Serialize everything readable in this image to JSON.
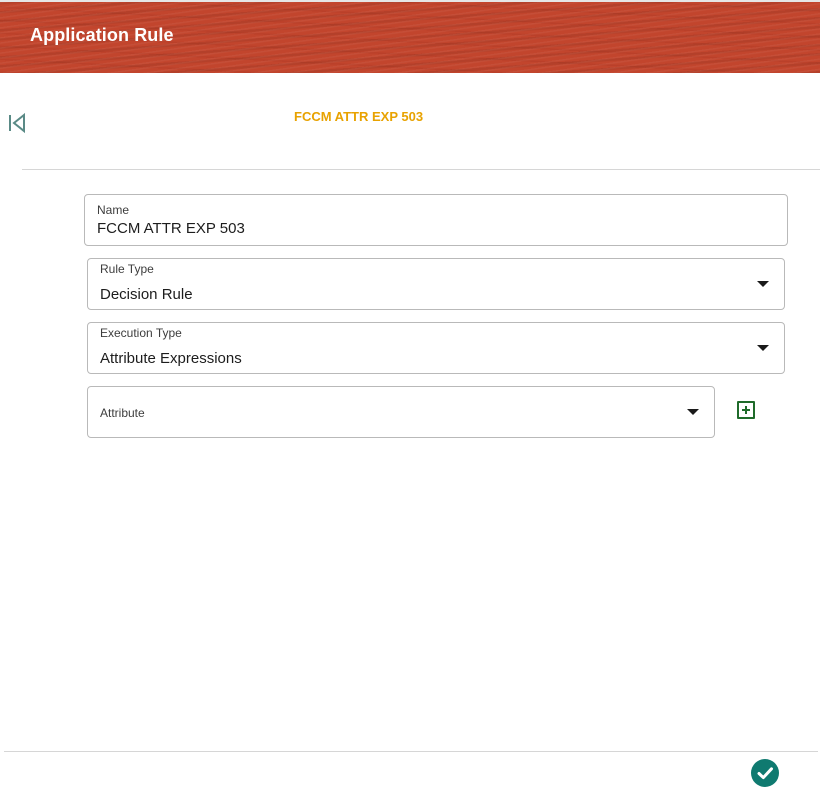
{
  "header": {
    "title": "Application Rule"
  },
  "record": {
    "title": "FCCM ATTR EXP 503"
  },
  "form": {
    "name": {
      "label": "Name",
      "value": "FCCM ATTR EXP 503"
    },
    "rule_type": {
      "label": "Rule Type",
      "value": "Decision Rule"
    },
    "execution_type": {
      "label": "Execution Type",
      "value": "Attribute Expressions"
    },
    "attribute": {
      "label": "Attribute",
      "value": ""
    }
  },
  "icons": {
    "back": "first-page-icon",
    "add": "add-square-icon",
    "submit": "check-circle-icon",
    "dropdown": "caret-down-icon"
  },
  "colors": {
    "header_bg": "#c2452d",
    "record_title": "#e8a200",
    "add_icon": "#1f6b2a",
    "submit_bg": "#0f7a70"
  }
}
